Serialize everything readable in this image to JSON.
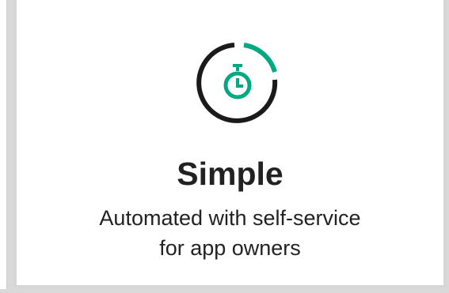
{
  "card": {
    "icon": "stopwatch-icon",
    "title": "Simple",
    "subtitle_line1": "Automated with self-service",
    "subtitle_line2": "for app owners"
  },
  "colors": {
    "accent": "#01a982",
    "text": "#222222",
    "arc_dark": "#1a1a1a",
    "background": "#d9d9d9",
    "card": "#ffffff"
  }
}
